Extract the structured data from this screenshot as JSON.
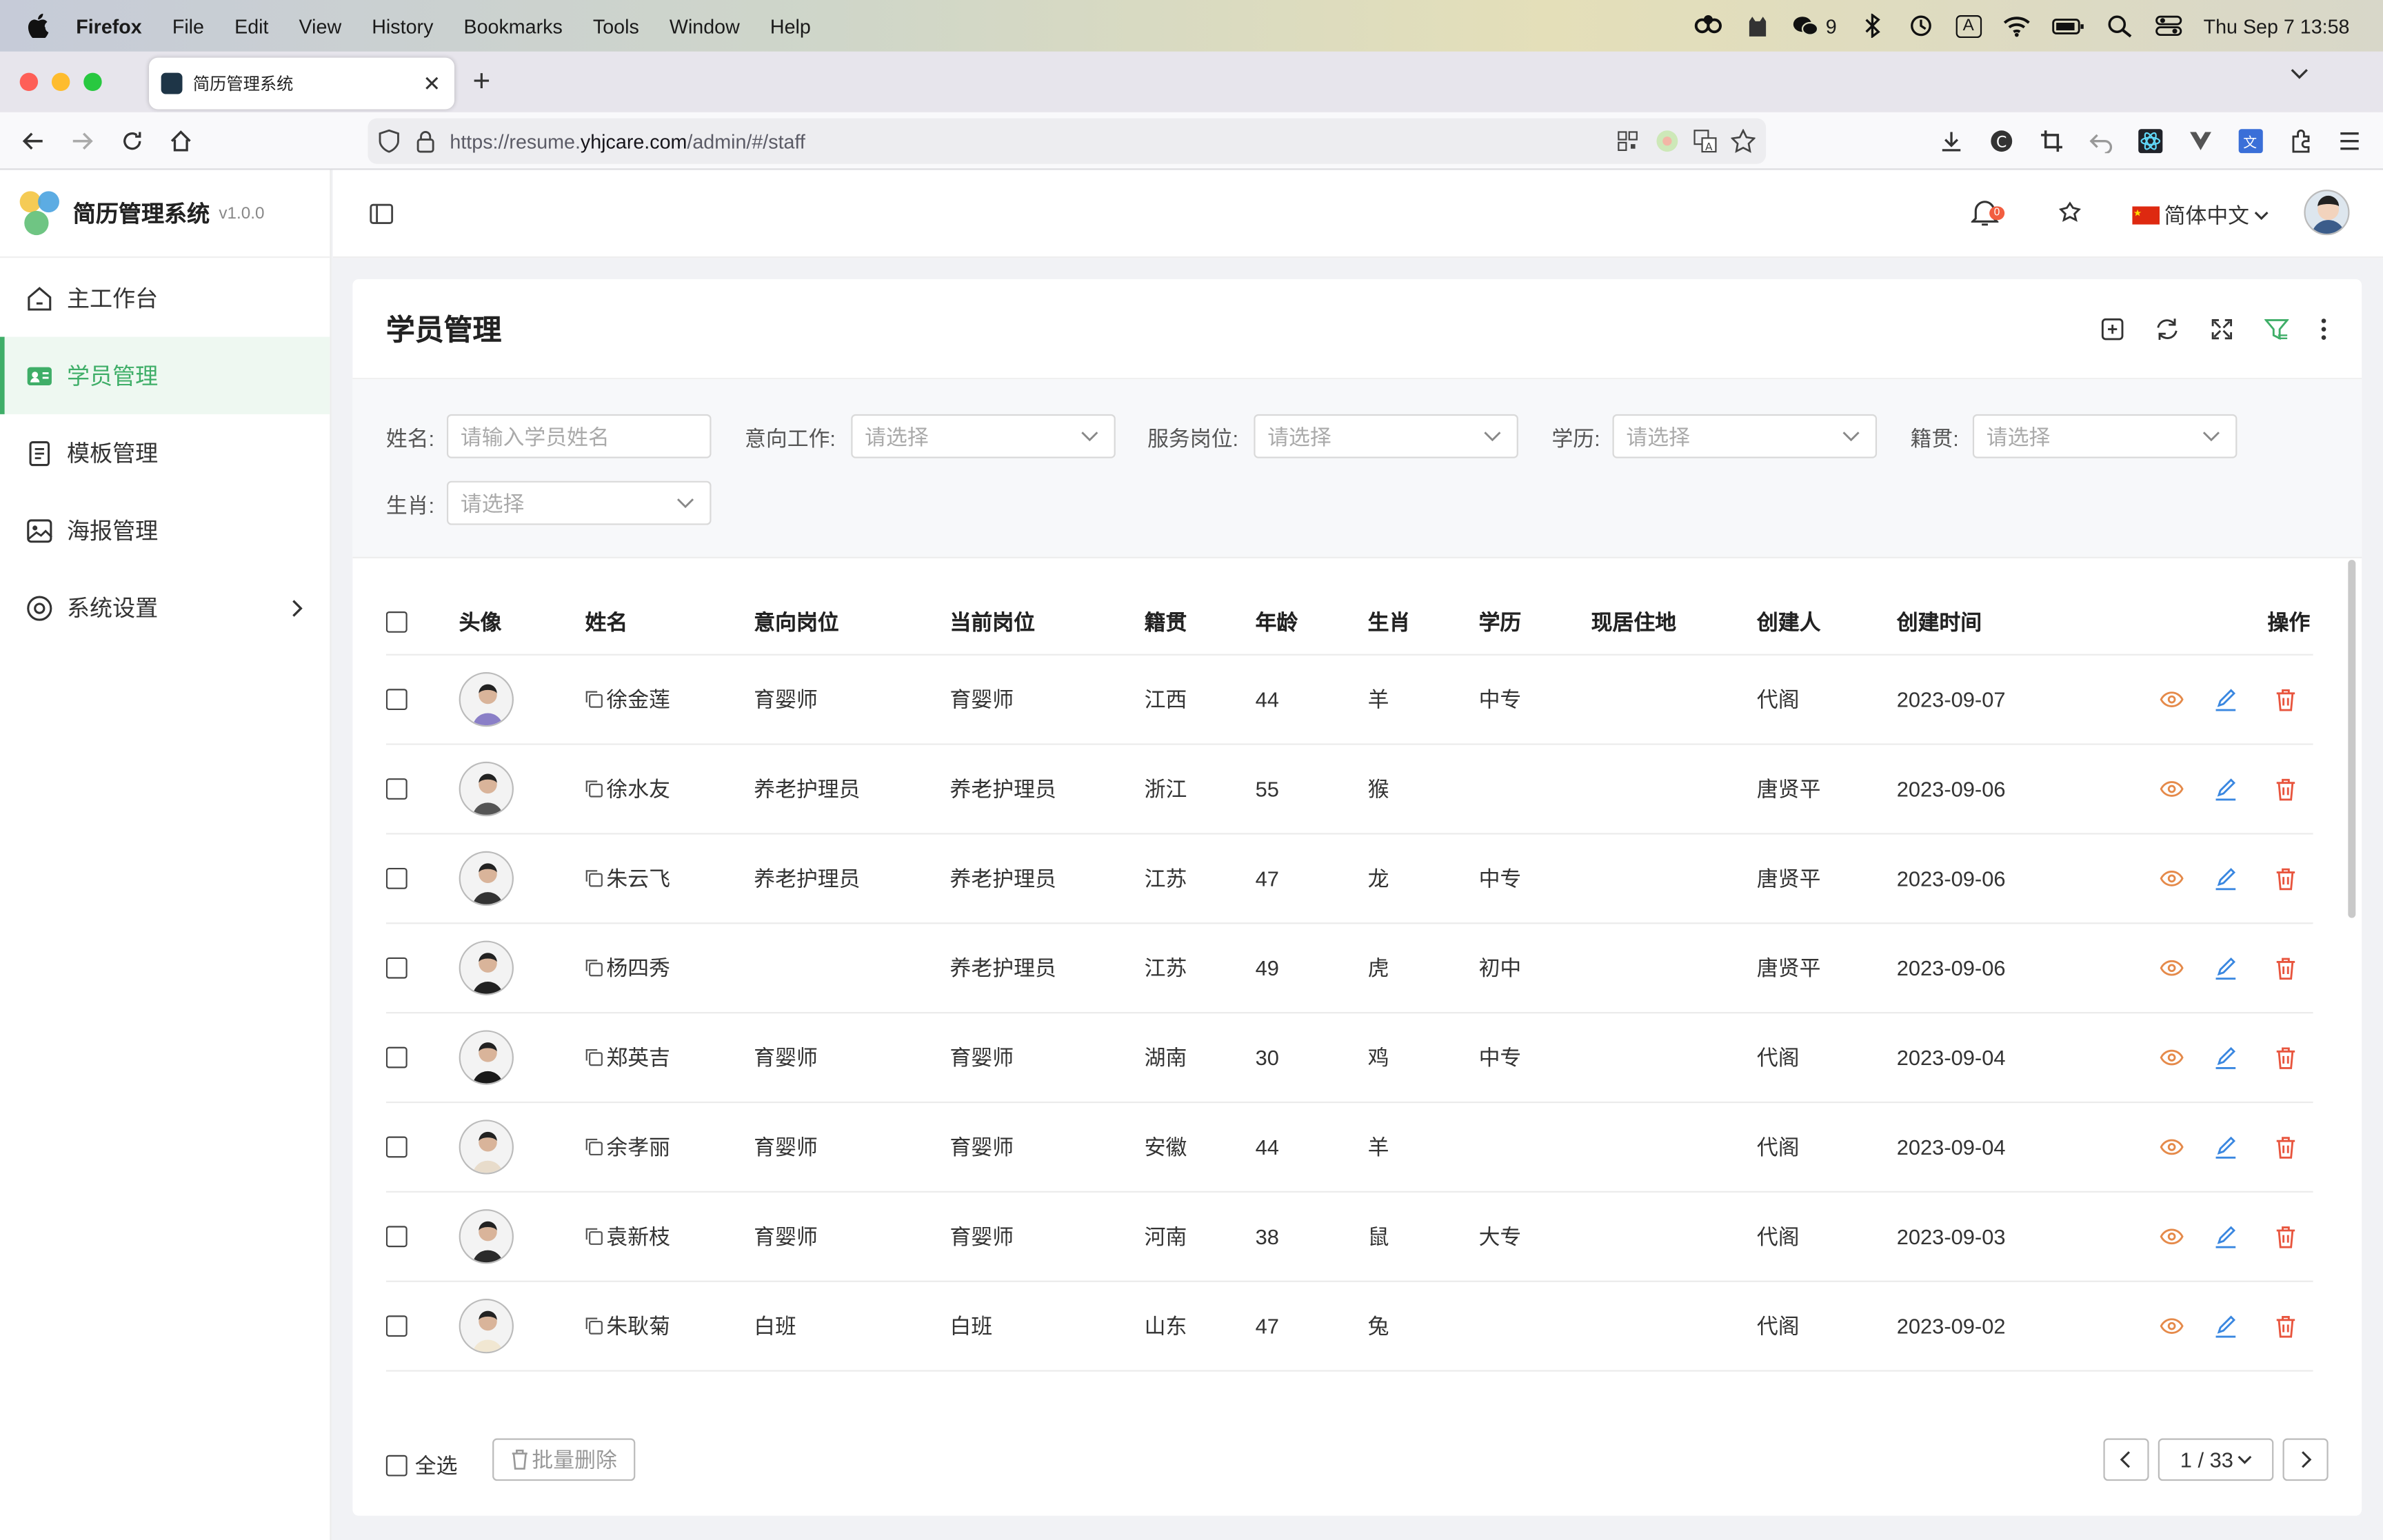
{
  "macos": {
    "app_name": "Firefox",
    "menus": [
      "File",
      "Edit",
      "View",
      "History",
      "Bookmarks",
      "Tools",
      "Window",
      "Help"
    ],
    "wechat_count": "9",
    "input_indicator": "A",
    "datetime": "Thu Sep 7  13:58"
  },
  "browser": {
    "tab_title": "简历管理系统",
    "url_prefix": "https://resume.",
    "url_host": "yhjcare.com",
    "url_path": "/admin/#/staff"
  },
  "app": {
    "name": "简历管理系统",
    "version": "v1.0.0",
    "sidebar": [
      {
        "label": "主工作台",
        "icon": "home-icon"
      },
      {
        "label": "学员管理",
        "icon": "id-card-icon",
        "active": true
      },
      {
        "label": "模板管理",
        "icon": "document-icon"
      },
      {
        "label": "海报管理",
        "icon": "image-icon"
      },
      {
        "label": "系统设置",
        "icon": "settings-icon",
        "has_submenu": true
      }
    ],
    "notification_count": "0",
    "language": "简体中文",
    "accent_color": "#3fae68"
  },
  "page": {
    "title": "学员管理",
    "filters": {
      "name_label": "姓名:",
      "name_placeholder": "请输入学员姓名",
      "intent_label": "意向工作:",
      "service_label": "服务岗位:",
      "education_label": "学历:",
      "origin_label": "籍贯:",
      "zodiac_label": "生肖:",
      "select_placeholder": "请选择"
    },
    "columns": [
      "头像",
      "姓名",
      "意向岗位",
      "当前岗位",
      "籍贯",
      "年龄",
      "生肖",
      "学历",
      "现居住地",
      "创建人",
      "创建时间",
      "操作"
    ],
    "rows": [
      {
        "name": "徐金莲",
        "intent": "育婴师",
        "current": "育婴师",
        "origin": "江西",
        "age": "44",
        "zodiac": "羊",
        "edu": "中专",
        "residence": "",
        "creator": "代阁",
        "created": "2023-09-07"
      },
      {
        "name": "徐水友",
        "intent": "养老护理员",
        "current": "养老护理员",
        "origin": "浙江",
        "age": "55",
        "zodiac": "猴",
        "edu": "",
        "residence": "",
        "creator": "唐贤平",
        "created": "2023-09-06"
      },
      {
        "name": "朱云飞",
        "intent": "养老护理员",
        "current": "养老护理员",
        "origin": "江苏",
        "age": "47",
        "zodiac": "龙",
        "edu": "中专",
        "residence": "",
        "creator": "唐贤平",
        "created": "2023-09-06"
      },
      {
        "name": "杨四秀",
        "intent": "",
        "current": "养老护理员",
        "origin": "江苏",
        "age": "49",
        "zodiac": "虎",
        "edu": "初中",
        "residence": "",
        "creator": "唐贤平",
        "created": "2023-09-06"
      },
      {
        "name": "郑英吉",
        "intent": "育婴师",
        "current": "育婴师",
        "origin": "湖南",
        "age": "30",
        "zodiac": "鸡",
        "edu": "中专",
        "residence": "",
        "creator": "代阁",
        "created": "2023-09-04"
      },
      {
        "name": "余孝丽",
        "intent": "育婴师",
        "current": "育婴师",
        "origin": "安徽",
        "age": "44",
        "zodiac": "羊",
        "edu": "",
        "residence": "",
        "creator": "代阁",
        "created": "2023-09-04"
      },
      {
        "name": "袁新枝",
        "intent": "育婴师",
        "current": "育婴师",
        "origin": "河南",
        "age": "38",
        "zodiac": "鼠",
        "edu": "大专",
        "residence": "",
        "creator": "代阁",
        "created": "2023-09-03"
      },
      {
        "name": "朱耿菊",
        "intent": "白班",
        "current": "白班",
        "origin": "山东",
        "age": "47",
        "zodiac": "兔",
        "edu": "",
        "residence": "",
        "creator": "代阁",
        "created": "2023-09-02"
      }
    ],
    "select_all_label": "全选",
    "batch_delete_label": "批量删除",
    "pagination": "1 / 33"
  }
}
